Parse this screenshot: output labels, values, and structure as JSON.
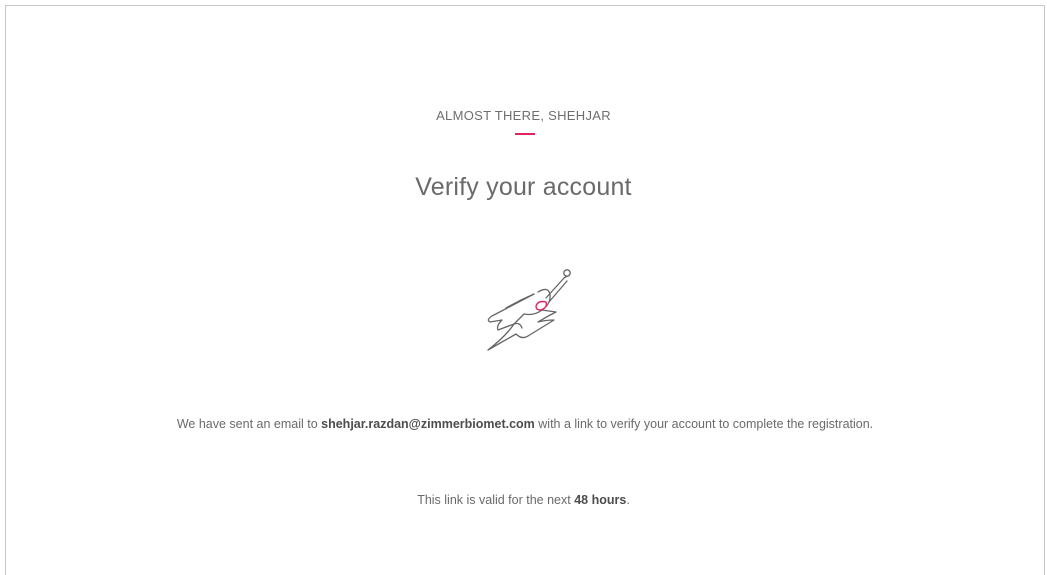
{
  "verification": {
    "eyebrow": "ALMOST THERE, SHEHJAR",
    "title": "Verify your account",
    "illustration_icon": "superhero-flying-icon",
    "accent_color": "#e0245e",
    "message_prefix": "We have sent an email to ",
    "email": "shehjar.razdan@zimmerbiomet.com",
    "message_suffix": " with a link to verify your account to complete the registration.",
    "validity_prefix": "This link is valid for the next ",
    "validity_value": "48 hours",
    "validity_suffix": "."
  }
}
